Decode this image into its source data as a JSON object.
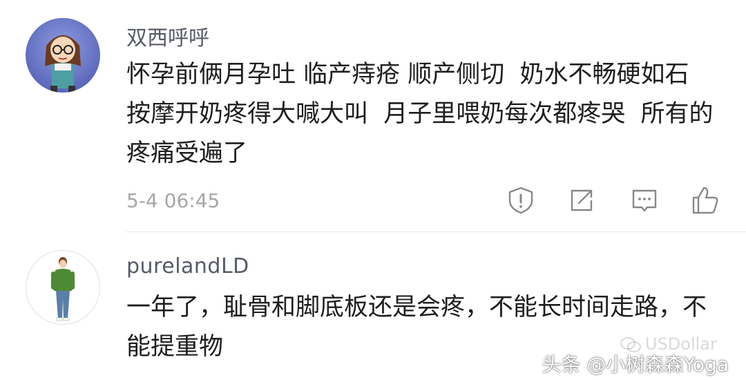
{
  "comments": [
    {
      "username": "双西呼呼",
      "text": "怀孕前俩月孕吐 临产痔疮 顺产侧切  奶水不畅硬如石  按摩开奶疼得大喊大叫  月子里喂奶每次都疼哭  所有的疼痛受遍了",
      "timestamp": "5-4 06:45",
      "actions": [
        "report-icon",
        "share-icon",
        "reply-icon",
        "like-icon"
      ]
    },
    {
      "username": "purelandLD",
      "text": "一年了，耻骨和脚底板还是会疼，不能长时间走路，不能提重物"
    }
  ],
  "watermark": {
    "brand": "头条 @小树森森Yoga",
    "ghost": "USDollar"
  }
}
